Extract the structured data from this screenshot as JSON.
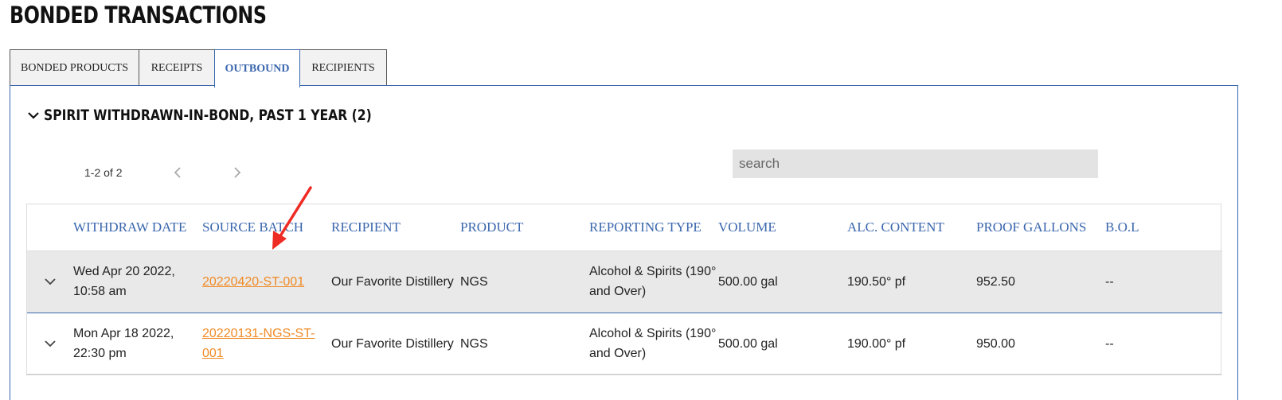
{
  "page": {
    "title": "BONDED TRANSACTIONS"
  },
  "tabs": [
    {
      "label": "BONDED PRODUCTS",
      "active": false
    },
    {
      "label": "RECEIPTS",
      "active": false
    },
    {
      "label": "OUTBOUND",
      "active": true
    },
    {
      "label": "RECIPIENTS",
      "active": false
    }
  ],
  "section": {
    "title": "SPIRIT WITHDRAWN-IN-BOND, PAST 1 YEAR (2)",
    "icon": "chevron-down-icon"
  },
  "pager": {
    "count": "1-2 of 2",
    "prev_icon": "chevron-left-icon",
    "next_icon": "chevron-right-icon"
  },
  "search": {
    "placeholder": "search",
    "value": ""
  },
  "table": {
    "headers": [
      "",
      "WITHDRAW DATE",
      "SOURCE BATCH",
      "RECIPIENT",
      "PRODUCT",
      "REPORTING TYPE",
      "VOLUME",
      "ALC. CONTENT",
      "PROOF GALLONS",
      "B.O.L"
    ],
    "rows": [
      {
        "withdraw_date": "Wed Apr 20 2022, 10:58 am",
        "source_batch": "20220420-ST-001",
        "recipient": "Our Favorite Distillery",
        "product": "NGS",
        "reporting_type": "Alcohol & Spirits (190° and Over)",
        "volume": "500.00 gal",
        "alc_content": "190.50° pf",
        "proof_gallons": "952.50",
        "bol": "--"
      },
      {
        "withdraw_date": "Mon Apr 18 2022, 22:30 pm",
        "source_batch": "20220131-NGS-ST-001",
        "recipient": "Our Favorite Distillery",
        "product": "NGS",
        "reporting_type": "Alcohol & Spirits (190° and Over)",
        "volume": "500.00 gal",
        "alc_content": "190.00° pf",
        "proof_gallons": "950.00",
        "bol": "--"
      }
    ]
  },
  "colors": {
    "accent": "#3a66ad",
    "link": "#f08a24",
    "annotation": "#ee2b24",
    "row_highlight": "#e9e9e9",
    "search_bg": "#e3e3e3"
  }
}
